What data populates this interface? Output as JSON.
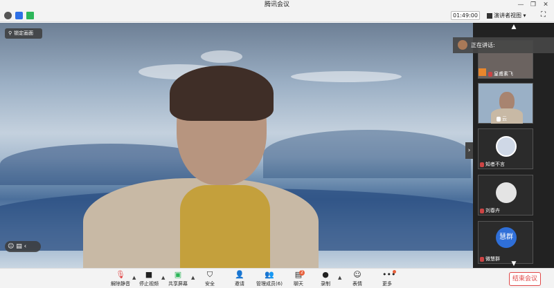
{
  "window": {
    "title": "腾讯会议"
  },
  "toolbar": {
    "timer": "01:49:00",
    "view_label": "演讲者视图"
  },
  "stage": {
    "lock_label": "锁定画面"
  },
  "speaking": {
    "label": "正在讲话:"
  },
  "participants": [
    {
      "name": "皇甫素飞"
    },
    {
      "name": "云"
    },
    {
      "name": "知者不言"
    },
    {
      "name": "刘春卉"
    },
    {
      "name": "微慧群",
      "avatar_text": "慧群"
    }
  ],
  "bottom": {
    "buttons": [
      {
        "label": "解除静音"
      },
      {
        "label": "停止视频"
      },
      {
        "label": "共享屏幕"
      },
      {
        "label": "安全"
      },
      {
        "label": "邀请"
      },
      {
        "label": "管理成员(6)"
      },
      {
        "label": "聊天"
      },
      {
        "label": "录制"
      },
      {
        "label": "表情"
      },
      {
        "label": "更多"
      }
    ],
    "end_label": "结束会议"
  },
  "colors": {
    "end": "#e04646",
    "stage_sky": "#9cb0c5",
    "panel": "#222222"
  }
}
